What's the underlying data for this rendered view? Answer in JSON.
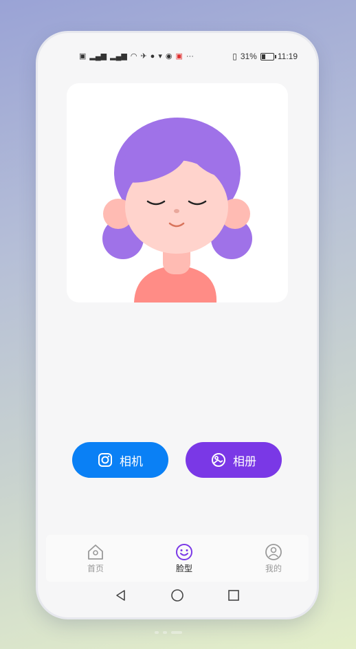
{
  "status": {
    "left_icons": [
      "HD",
      "signal-1",
      "signal-2",
      "wifi",
      "sync",
      "shopping",
      "globe",
      "app"
    ],
    "battery_percent": "31%",
    "time": "11:19"
  },
  "buttons": {
    "camera_label": "相机",
    "album_label": "相册"
  },
  "tabs": [
    {
      "label": "首页",
      "icon": "home-icon",
      "active": false
    },
    {
      "label": "脸型",
      "icon": "smile-icon",
      "active": true
    },
    {
      "label": "我的",
      "icon": "user-icon",
      "active": false
    }
  ],
  "colors": {
    "camera_button": "#0a80f5",
    "album_button": "#7a38e6",
    "active_tab": "#7a38e6",
    "hair": "#9f72e8"
  }
}
